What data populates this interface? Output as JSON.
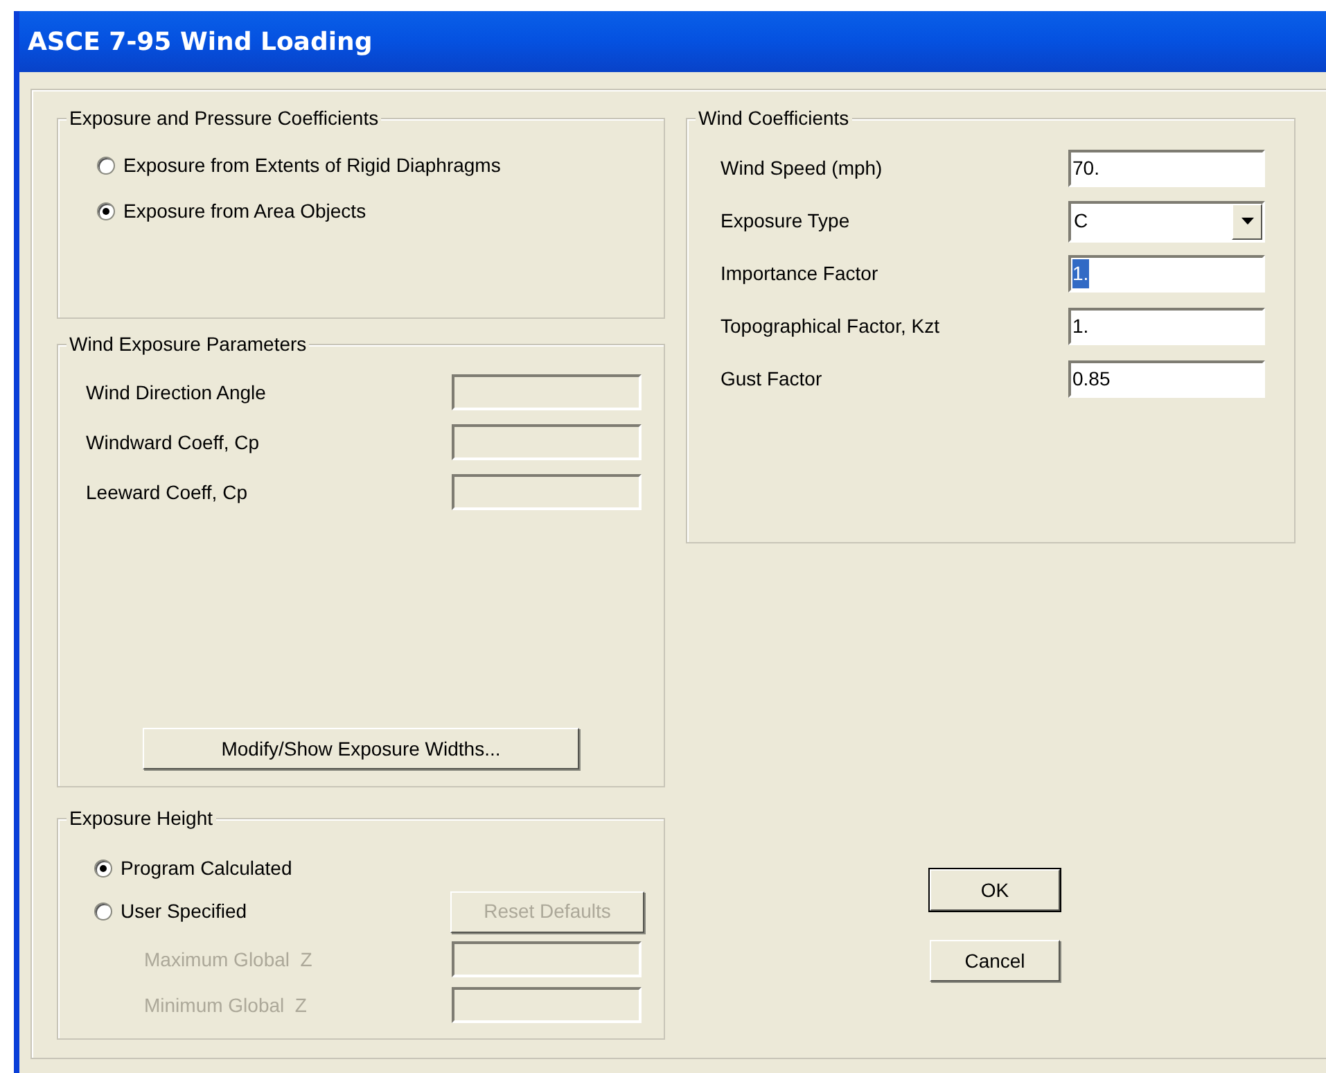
{
  "window": {
    "title": "ASCE 7-95 Wind Loading"
  },
  "exposure_and_pressure": {
    "title": "Exposure and Pressure Coefficients",
    "options": [
      {
        "label": "Exposure from Extents of Rigid Diaphragms",
        "selected": false
      },
      {
        "label": "Exposure from Area Objects",
        "selected": true
      }
    ]
  },
  "wind_exposure_parameters": {
    "title": "Wind Exposure Parameters",
    "fields": [
      {
        "label": "Wind Direction Angle",
        "disabled": true
      },
      {
        "label": "Windward Coeff, Cp",
        "disabled": true
      },
      {
        "label": "Leeward Coeff, Cp",
        "disabled": true
      }
    ],
    "button": {
      "label": "Modify/Show Exposure Widths..."
    }
  },
  "exposure_height": {
    "title": "Exposure Height",
    "options": [
      {
        "label": "Program Calculated",
        "selected": true
      },
      {
        "label": "User Specified",
        "selected": false
      }
    ],
    "reset_button": {
      "label": "Reset Defaults",
      "disabled": true
    },
    "fields": [
      {
        "label": "Maximum Global  Z",
        "disabled": true
      },
      {
        "label": "Minimum Global  Z",
        "disabled": true
      }
    ]
  },
  "wind_coefficients": {
    "title": "Wind Coefficients",
    "fields": [
      {
        "label": "Wind Speed (mph)",
        "value": "70.",
        "kind": "text"
      },
      {
        "label": "Exposure Type",
        "value": "C",
        "kind": "dropdown"
      },
      {
        "label": "Importance Factor",
        "value": "1.",
        "kind": "text",
        "text_selected": true
      },
      {
        "label": "Topographical Factor, Kzt",
        "value": "1.",
        "kind": "text"
      },
      {
        "label": "Gust Factor",
        "value": "0.85",
        "kind": "text"
      }
    ]
  },
  "buttons": [
    {
      "label": "OK",
      "default": true
    },
    {
      "label": "Cancel",
      "default": false
    }
  ]
}
